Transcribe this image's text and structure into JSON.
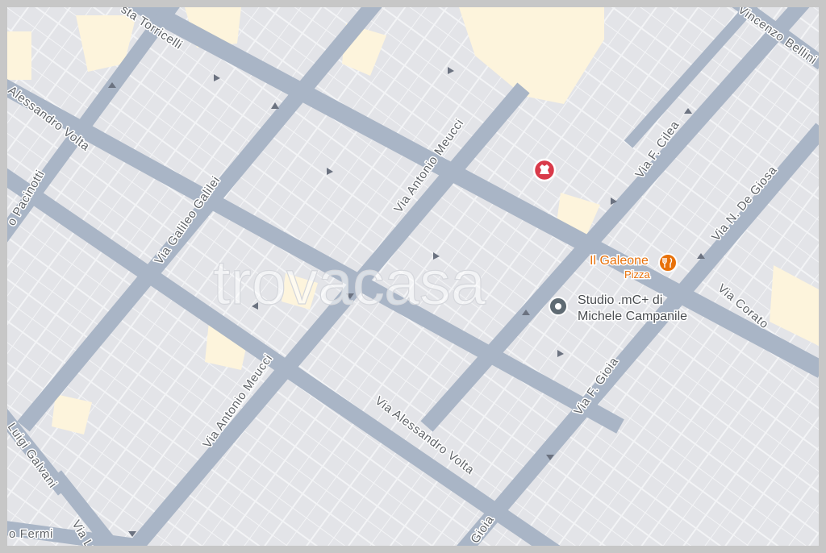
{
  "map": {
    "watermark": "trovacasa",
    "colors": {
      "road": "#a9b5c6",
      "block": "#e3e4e8",
      "building_outline": "#f3f4f6",
      "highlight": "#fdf4dc",
      "marker": "#d93a4a",
      "restaurant": "#e8710a",
      "place": "#5f6b73"
    },
    "streets": {
      "torricelli": "sta Torricelli",
      "bellini": "Vincenzo Bellini",
      "volta_nw": "Alessandro Volta",
      "pacinotti": "o Pacinotti",
      "galilei": "Via Galileo Galilei",
      "meucci_n": "Via Antonio Meucci",
      "cilea": "Via F. Cilea",
      "de_giosa": "Via N. De Giosa",
      "corato": "Via Corato",
      "gioia_mid": "Via F. Gioia",
      "meucci_s": "Via Antonio Meucci",
      "volta_se": "Via Alessandro Volta",
      "galvani": "Luigi Galvani",
      "fermi": "o Fermi",
      "luigi": "Via Lu",
      "gioia_bottom": "Gioia"
    },
    "pois": {
      "galeone_name": "Il Galeone",
      "galeone_category": "Pizza",
      "galeone_icon": "restaurant-icon",
      "studio_line1": "Studio .mC+ di",
      "studio_line2": "Michele Campanile",
      "studio_icon": "place-pin-icon",
      "listing_icon": "listing-marker-icon"
    }
  }
}
